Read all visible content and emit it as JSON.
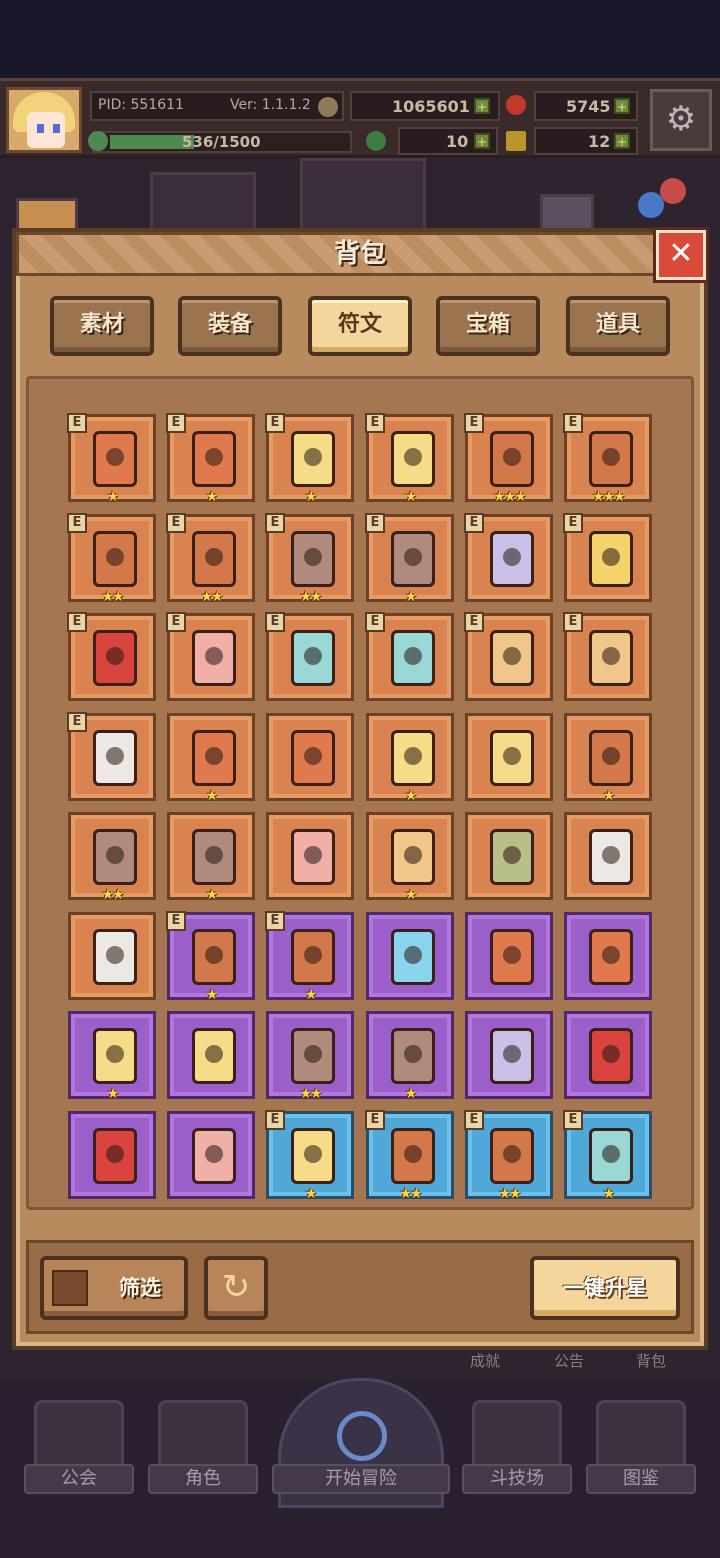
{
  "hud": {
    "pid": "PID: 551611",
    "version": "Ver: 1.1.1.2",
    "gold": "1065601",
    "gems": "5745",
    "exp": "536/1500",
    "exp_fraction": 0.357,
    "clover": "10",
    "key": "12"
  },
  "modal": {
    "title": "背包",
    "tabs": [
      "素材",
      "装备",
      "符文",
      "宝箱",
      "道具"
    ],
    "active_tab": "符文"
  },
  "items": [
    {
      "bg": "orange",
      "color": "#e07a4e",
      "e": true,
      "stars": "★"
    },
    {
      "bg": "orange",
      "color": "#e07a4e",
      "e": true,
      "stars": "★"
    },
    {
      "bg": "orange",
      "color": "#f6dc88",
      "e": true,
      "stars": "★"
    },
    {
      "bg": "orange",
      "color": "#f6dc88",
      "e": true,
      "stars": "★"
    },
    {
      "bg": "orange",
      "color": "#d2784a",
      "e": true,
      "stars": "★★★"
    },
    {
      "bg": "orange",
      "color": "#d2784a",
      "e": true,
      "stars": "★★★"
    },
    {
      "bg": "orange",
      "color": "#d2784a",
      "e": true,
      "stars": "★★"
    },
    {
      "bg": "orange",
      "color": "#d2784a",
      "e": true,
      "stars": "★★"
    },
    {
      "bg": "orange",
      "color": "#b08a7c",
      "e": true,
      "stars": "★★"
    },
    {
      "bg": "orange",
      "color": "#b08a7c",
      "e": true,
      "stars": "★"
    },
    {
      "bg": "orange",
      "color": "#c9c0e8",
      "e": true,
      "stars": ""
    },
    {
      "bg": "orange",
      "color": "#f4d36a",
      "e": true,
      "stars": ""
    },
    {
      "bg": "orange",
      "color": "#d9443e",
      "e": true,
      "stars": ""
    },
    {
      "bg": "orange",
      "color": "#f0b0a8",
      "e": true,
      "stars": ""
    },
    {
      "bg": "orange",
      "color": "#9ad8d8",
      "e": true,
      "stars": ""
    },
    {
      "bg": "orange",
      "color": "#9ad8d8",
      "e": true,
      "stars": ""
    },
    {
      "bg": "orange",
      "color": "#f0c68a",
      "e": true,
      "stars": ""
    },
    {
      "bg": "orange",
      "color": "#f0c68a",
      "e": true,
      "stars": ""
    },
    {
      "bg": "orange",
      "color": "#ece8e4",
      "e": true,
      "stars": ""
    },
    {
      "bg": "orange",
      "color": "#e07a4e",
      "e": false,
      "stars": "★"
    },
    {
      "bg": "orange",
      "color": "#e07a4e",
      "e": false,
      "stars": ""
    },
    {
      "bg": "orange",
      "color": "#f6dc88",
      "e": false,
      "stars": "★"
    },
    {
      "bg": "orange",
      "color": "#f6dc88",
      "e": false,
      "stars": ""
    },
    {
      "bg": "orange",
      "color": "#d2784a",
      "e": false,
      "stars": "★"
    },
    {
      "bg": "orange",
      "color": "#b08a7c",
      "e": false,
      "stars": "★★"
    },
    {
      "bg": "orange",
      "color": "#b08a7c",
      "e": false,
      "stars": "★"
    },
    {
      "bg": "orange",
      "color": "#f0b0a8",
      "e": false,
      "stars": ""
    },
    {
      "bg": "orange",
      "color": "#f0c68a",
      "e": false,
      "stars": "★"
    },
    {
      "bg": "orange",
      "color": "#b8c088",
      "e": false,
      "stars": ""
    },
    {
      "bg": "orange",
      "color": "#ece8e4",
      "e": false,
      "stars": ""
    },
    {
      "bg": "orange",
      "color": "#ece8e4",
      "e": false,
      "stars": ""
    },
    {
      "bg": "purple",
      "color": "#d2784a",
      "e": true,
      "stars": "★"
    },
    {
      "bg": "purple",
      "color": "#d2784a",
      "e": true,
      "stars": "★"
    },
    {
      "bg": "purple",
      "color": "#8ad4ee",
      "e": false,
      "stars": ""
    },
    {
      "bg": "purple",
      "color": "#e07a4e",
      "e": false,
      "stars": ""
    },
    {
      "bg": "purple",
      "color": "#e07a4e",
      "e": false,
      "stars": ""
    },
    {
      "bg": "purple",
      "color": "#f6dc88",
      "e": false,
      "stars": "★"
    },
    {
      "bg": "purple",
      "color": "#f6dc88",
      "e": false,
      "stars": ""
    },
    {
      "bg": "purple",
      "color": "#b08a7c",
      "e": false,
      "stars": "★★"
    },
    {
      "bg": "purple",
      "color": "#b08a7c",
      "e": false,
      "stars": "★"
    },
    {
      "bg": "purple",
      "color": "#c9c0e8",
      "e": false,
      "stars": ""
    },
    {
      "bg": "purple",
      "color": "#d9443e",
      "e": false,
      "stars": ""
    },
    {
      "bg": "purple",
      "color": "#d9443e",
      "e": false,
      "stars": ""
    },
    {
      "bg": "purple",
      "color": "#f0b0a8",
      "e": false,
      "stars": ""
    },
    {
      "bg": "blue",
      "color": "#f6dc88",
      "e": true,
      "stars": "★"
    },
    {
      "bg": "blue",
      "color": "#d2784a",
      "e": true,
      "stars": "★★"
    },
    {
      "bg": "blue",
      "color": "#d2784a",
      "e": true,
      "stars": "★★"
    },
    {
      "bg": "blue",
      "color": "#9ad8d8",
      "e": true,
      "stars": "★"
    }
  ],
  "e_badge": "E",
  "footer": {
    "filter_label": "筛选",
    "upgrade_label": "一键升星"
  },
  "shortcuts": [
    "成就",
    "公告",
    "背包"
  ],
  "nav": [
    "公会",
    "角色",
    "开始冒险",
    "斗技场",
    "图鉴"
  ]
}
